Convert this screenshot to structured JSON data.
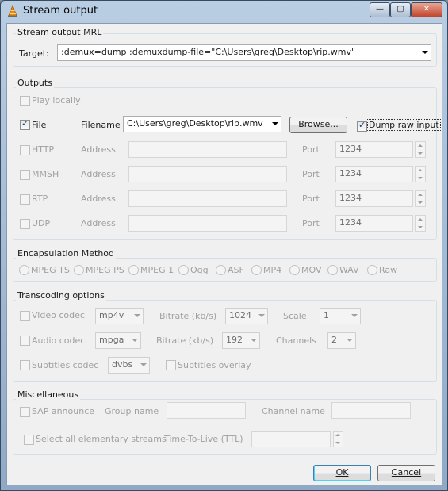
{
  "window": {
    "title": "Stream output",
    "minimize_glyph": "—",
    "maximize_glyph": "▢",
    "close_glyph": "✕"
  },
  "mrl": {
    "group_title": "Stream output MRL",
    "target_label": "Target:",
    "target_value": ":demux=dump :demuxdump-file=\"C:\\Users\\greg\\Desktop\\rip.wmv\""
  },
  "outputs": {
    "group_title": "Outputs",
    "play_locally": "Play locally",
    "file_label": "File",
    "filename_label": "Filename",
    "filename_value": "C:\\Users\\greg\\Desktop\\rip.wmv",
    "browse_button": "Browse...",
    "dump_raw_input": "Dump raw input",
    "rows": [
      {
        "name": "HTTP",
        "address_label": "Address",
        "port_label": "Port",
        "port_value": "1234"
      },
      {
        "name": "MMSH",
        "address_label": "Address",
        "port_label": "Port",
        "port_value": "1234"
      },
      {
        "name": "RTP",
        "address_label": "Address",
        "port_label": "Port",
        "port_value": "1234"
      },
      {
        "name": "UDP",
        "address_label": "Address",
        "port_label": "Port",
        "port_value": "1234"
      }
    ]
  },
  "encapsulation": {
    "group_title": "Encapsulation Method",
    "options": [
      "MPEG TS",
      "MPEG PS",
      "MPEG 1",
      "Ogg",
      "ASF",
      "MP4",
      "MOV",
      "WAV",
      "Raw"
    ]
  },
  "transcoding": {
    "group_title": "Transcoding options",
    "video_codec_label": "Video codec",
    "video_codec_value": "mp4v",
    "video_bitrate_label": "Bitrate (kb/s)",
    "video_bitrate_value": "1024",
    "scale_label": "Scale",
    "scale_value": "1",
    "audio_codec_label": "Audio codec",
    "audio_codec_value": "mpga",
    "audio_bitrate_label": "Bitrate (kb/s)",
    "audio_bitrate_value": "192",
    "channels_label": "Channels",
    "channels_value": "2",
    "subtitles_codec_label": "Subtitles codec",
    "subtitles_codec_value": "dvbs",
    "subtitles_overlay_label": "Subtitles overlay"
  },
  "misc": {
    "group_title": "Miscellaneous",
    "sap_announce": "SAP announce",
    "group_name_label": "Group name",
    "channel_name_label": "Channel name",
    "select_all_streams": "Select all elementary streams",
    "ttl_label": "Time-To-Live (TTL)"
  },
  "footer": {
    "ok_button": "OK",
    "cancel_button": "Cancel"
  }
}
